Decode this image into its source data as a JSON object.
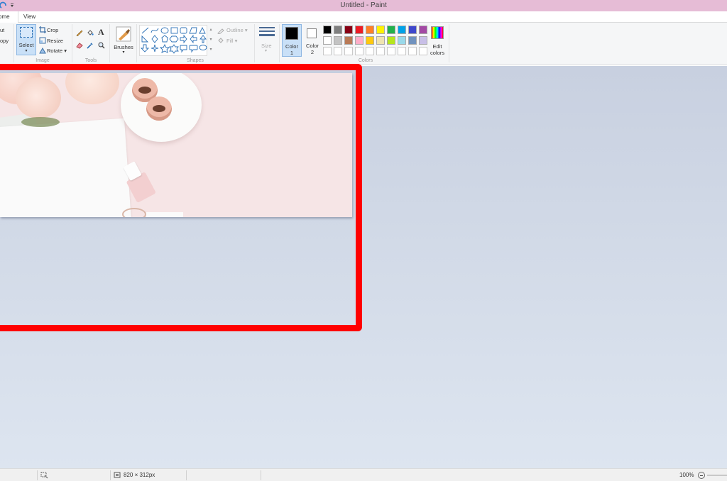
{
  "window": {
    "title": "Untitled - Paint"
  },
  "tabs": {
    "home": "ome",
    "view": "View"
  },
  "ribbon": {
    "clipboard": {
      "cut": "ut",
      "copy": "opy"
    },
    "image": {
      "label": "Image",
      "select": "Select",
      "crop": "Crop",
      "resize": "Resize",
      "rotate": "Rotate"
    },
    "tools": {
      "label": "Tools"
    },
    "brushes": {
      "label": "Brushes"
    },
    "shapes": {
      "label": "Shapes",
      "outline": "Outline",
      "fill": "Fill"
    },
    "size": {
      "label": "Size"
    },
    "colors": {
      "label": "Colors",
      "color1": "Color",
      "color1_num": "1",
      "color2": "Color",
      "color2_num": "2",
      "edit_colors": "Edit",
      "edit_colors2": "colors",
      "active_color": "#000000",
      "secondary_color": "#ffffff",
      "palette_row1": [
        "#000000",
        "#7f7f7f",
        "#880015",
        "#ed1c24",
        "#ff7f27",
        "#fff200",
        "#22b14c",
        "#00a2e8",
        "#3f48cc",
        "#a349a4"
      ],
      "palette_row2": [
        "#ffffff",
        "#c3c3c3",
        "#b97a57",
        "#ffaec9",
        "#ffc90e",
        "#efe4b0",
        "#b5e61d",
        "#99d9ea",
        "#7092be",
        "#c8bfe7"
      ],
      "palette_row3": [
        "#ffffff",
        "#ffffff",
        "#ffffff",
        "#ffffff",
        "#ffffff",
        "#ffffff",
        "#ffffff",
        "#ffffff",
        "#ffffff",
        "#ffffff"
      ]
    }
  },
  "canvas": {
    "annotation_color": "#ff0000"
  },
  "statusbar": {
    "dimensions": "820 × 312px",
    "zoom": "100%"
  }
}
